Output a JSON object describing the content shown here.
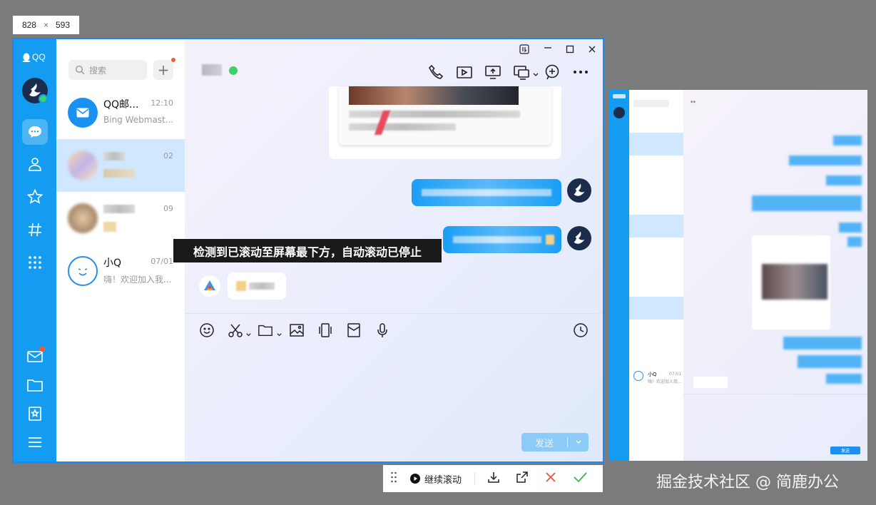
{
  "size_indicator": {
    "width": "828",
    "x": "×",
    "height": "593"
  },
  "app": {
    "logo": "QQ"
  },
  "left_rail": {
    "icons": [
      "chat-icon",
      "contacts-icon",
      "star-icon",
      "hash-icon",
      "apps-icon"
    ],
    "bottom_icons": [
      "mail-icon",
      "folder-icon",
      "bookmark-icon",
      "menu-icon"
    ],
    "accent": "#139cf2"
  },
  "search": {
    "placeholder": "搜索"
  },
  "conversations": [
    {
      "name": "QQ邮...",
      "time": "12:10",
      "preview": "Bing Webmast..."
    },
    {
      "name": "",
      "time": "02",
      "preview": ""
    },
    {
      "name": "",
      "time": "09",
      "preview": ""
    },
    {
      "name": "小Q",
      "time": "07/01",
      "preview": "嗨！欢迎加入我..."
    }
  ],
  "notice": {
    "text": "检测到已滚动至屏幕最下方，自动滚动已停止"
  },
  "send_button": {
    "label": "发送"
  },
  "scroll_toolbar": {
    "continue_label": "继续滚动"
  },
  "preview_panel": {
    "conv_name": "小Q",
    "conv_time": "07/01",
    "conv_preview": "嗨！欢迎加入我...",
    "send_label": "发送",
    "header_name": "**"
  },
  "watermark": {
    "text": "掘金技术社区 @ 简鹿办公"
  }
}
